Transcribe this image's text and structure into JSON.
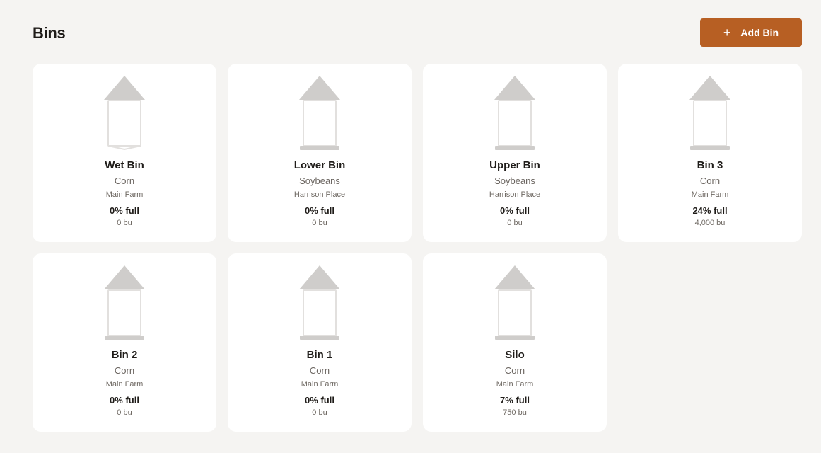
{
  "header": {
    "title": "Bins",
    "add_label": "Add Bin"
  },
  "bins": [
    {
      "name": "Wet Bin",
      "crop": "Corn",
      "farm": "Main Farm",
      "fill_label": "0% full",
      "bushels": "0 bu",
      "fill_fraction": 0,
      "base": "hopper"
    },
    {
      "name": "Lower Bin",
      "crop": "Soybeans",
      "farm": "Harrison Place",
      "fill_label": "0% full",
      "bushels": "0 bu",
      "fill_fraction": 0,
      "base": "flat"
    },
    {
      "name": "Upper Bin",
      "crop": "Soybeans",
      "farm": "Harrison Place",
      "fill_label": "0% full",
      "bushels": "0 bu",
      "fill_fraction": 0,
      "base": "flat"
    },
    {
      "name": "Bin 3",
      "crop": "Corn",
      "farm": "Main Farm",
      "fill_label": "24% full",
      "bushels": "4,000 bu",
      "fill_fraction": 0.24,
      "base": "flat"
    },
    {
      "name": "Bin 2",
      "crop": "Corn",
      "farm": "Main Farm",
      "fill_label": "0% full",
      "bushels": "0 bu",
      "fill_fraction": 0,
      "base": "flat"
    },
    {
      "name": "Bin 1",
      "crop": "Corn",
      "farm": "Main Farm",
      "fill_label": "0% full",
      "bushels": "0 bu",
      "fill_fraction": 0,
      "base": "flat"
    },
    {
      "name": "Silo",
      "crop": "Corn",
      "farm": "Main Farm",
      "fill_label": "7% full",
      "bushels": "750 bu",
      "fill_fraction": 0.07,
      "base": "flat"
    }
  ],
  "colors": {
    "accent": "#b75f23",
    "background": "#f5f4f2",
    "card": "#ffffff",
    "bin_shape": "#cfcdcb",
    "bin_body": "#e2e0de"
  }
}
